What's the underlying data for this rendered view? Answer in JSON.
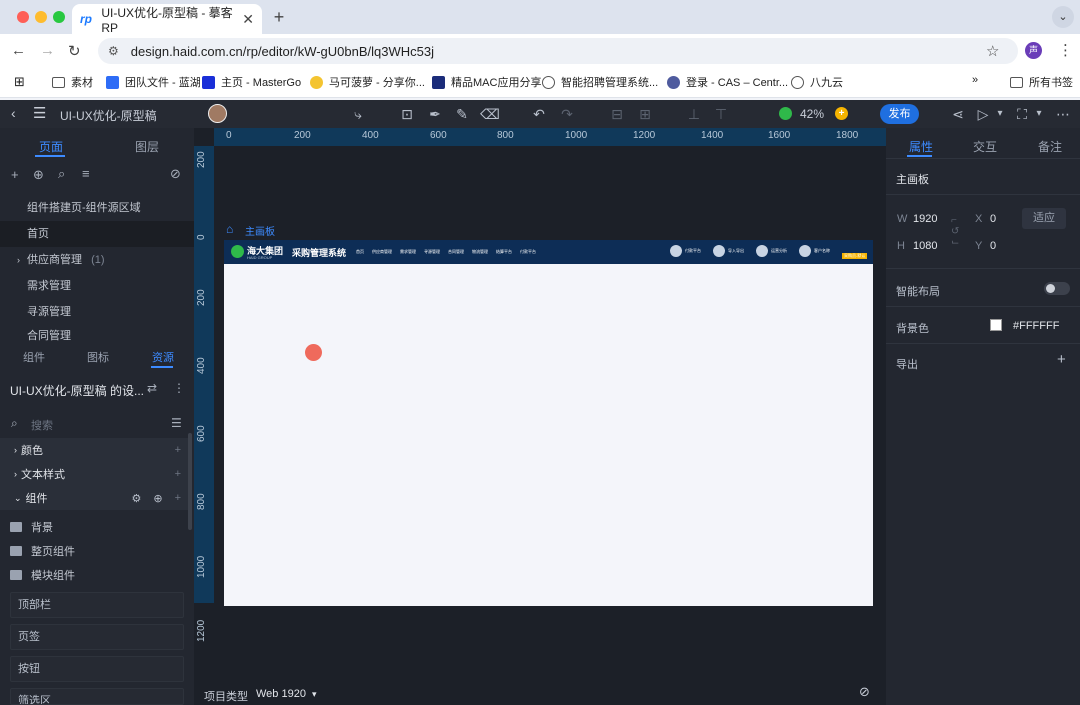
{
  "browser": {
    "tab_title": "UI-UX优化-原型稿 - 摹客RP",
    "url": "design.haid.com.cn/rp/editor/kW-gU0bnB/lq3WHc53j",
    "bookmarks": [
      "素材",
      "团队文件 - 蓝湖",
      "主页 - MasterGo",
      "马可菠萝 - 分享你...",
      "精品MAC应用分享",
      "智能招聘管理系统...",
      "登录 - CAS – Centr...",
      "八九云"
    ],
    "all_bookmarks": "所有书签",
    "profile_initial": "声"
  },
  "app": {
    "project_title": "UI-UX优化-原型稿",
    "zoom": "42%",
    "publish_label": "发布"
  },
  "left_panel": {
    "tabs": [
      "页面",
      "图层"
    ],
    "pages": [
      "组件搭建页-组件源区域",
      "首页",
      "供应商管理",
      "需求管理",
      "寻源管理",
      "合同管理"
    ],
    "pages_count": "(1)",
    "bottom_tabs": [
      "组件",
      "图标",
      "资源"
    ],
    "library_title": "UI-UX优化-原型稿 的设...",
    "search_placeholder": "搜索",
    "sections": [
      "颜色",
      "文本样式",
      "组件"
    ],
    "folders": [
      "背景",
      "整页组件",
      "模块组件"
    ],
    "components": [
      "顶部栏",
      "页签",
      "按钮",
      "筛选区"
    ]
  },
  "canvas": {
    "ruler_h": [
      "0",
      "200",
      "400",
      "600",
      "800",
      "1000",
      "1200",
      "1400",
      "1600",
      "1800"
    ],
    "ruler_v": [
      "200",
      "0",
      "200",
      "400",
      "600",
      "800",
      "1000",
      "1200"
    ],
    "artboard_label": "主画板",
    "banner": {
      "brand": "海大集团",
      "brand_sub": "HAID GROUP",
      "system": "采购管理系统",
      "menu": [
        "首页",
        "供应商管理",
        "需求管理",
        "寻源管理",
        "合同管理",
        "物流管理",
        "结算平台",
        "付款平台"
      ],
      "right": [
        "付款平台",
        "导入导出",
        "运营分析",
        "客户名称"
      ],
      "badge": "采购员-默认"
    },
    "project_type_label": "项目类型",
    "project_type_value": "Web 1920"
  },
  "right_panel": {
    "tabs": [
      "属性",
      "交互",
      "备注"
    ],
    "section_title": "主画板",
    "w_label": "W",
    "w_value": "1920",
    "h_label": "H",
    "h_value": "1080",
    "x_label": "X",
    "x_value": "0",
    "y_label": "Y",
    "y_value": "0",
    "fit_label": "适应",
    "smart_layout": "智能布局",
    "bg_label": "背景色",
    "bg_value": "#FFFFFF",
    "export_label": "导出"
  },
  "colors": {
    "accent": "#3d8bff",
    "publish": "#1f6fe0",
    "marker": "#ef6a5c"
  }
}
